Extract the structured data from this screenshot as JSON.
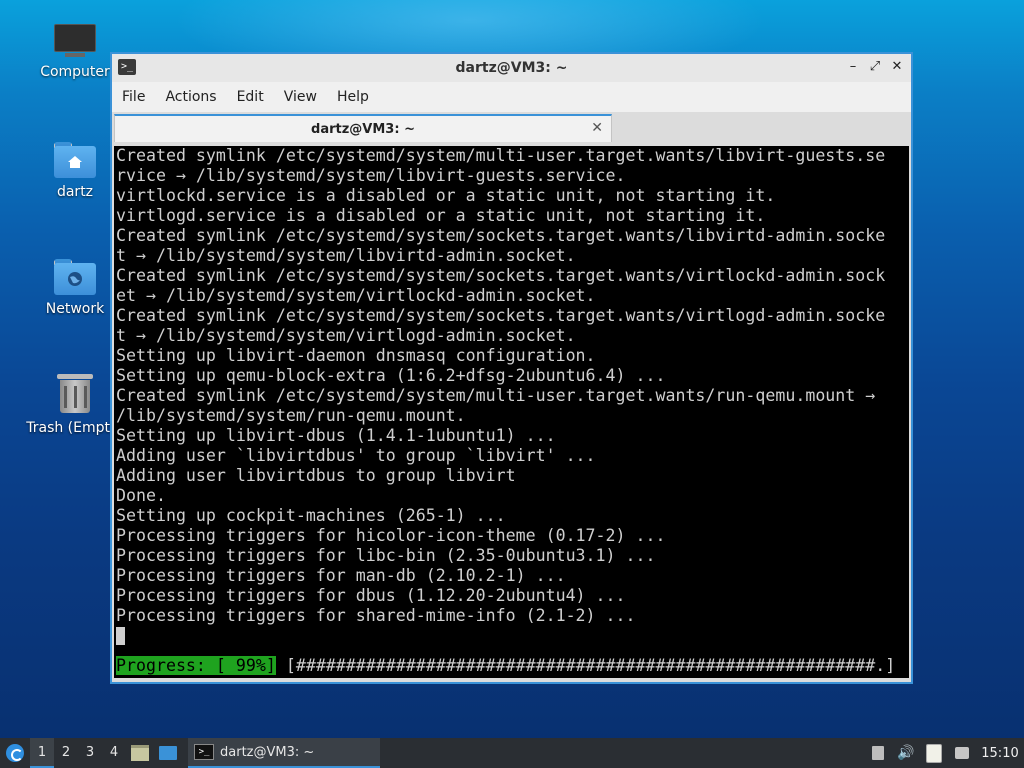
{
  "desktop": {
    "icons": [
      {
        "label": "Computer"
      },
      {
        "label": "dartz"
      },
      {
        "label": "Network"
      },
      {
        "label": "Trash (Empty)"
      }
    ]
  },
  "window": {
    "title": "dartz@VM3: ~",
    "app_icon": ">_",
    "menu": [
      "File",
      "Actions",
      "Edit",
      "View",
      "Help"
    ],
    "tab_label": "dartz@VM3: ~",
    "tab_close": "✕",
    "controls": {
      "minimize": "–",
      "maximize": "⤢",
      "close": "✕"
    }
  },
  "terminal": {
    "lines": [
      "Created symlink /etc/systemd/system/multi-user.target.wants/libvirt-guests.se",
      "rvice → /lib/systemd/system/libvirt-guests.service.",
      "virtlockd.service is a disabled or a static unit, not starting it.",
      "virtlogd.service is a disabled or a static unit, not starting it.",
      "Created symlink /etc/systemd/system/sockets.target.wants/libvirtd-admin.socke",
      "t → /lib/systemd/system/libvirtd-admin.socket.",
      "Created symlink /etc/systemd/system/sockets.target.wants/virtlockd-admin.sock",
      "et → /lib/systemd/system/virtlockd-admin.socket.",
      "Created symlink /etc/systemd/system/sockets.target.wants/virtlogd-admin.socke",
      "t → /lib/systemd/system/virtlogd-admin.socket.",
      "Setting up libvirt-daemon dnsmasq configuration.",
      "Setting up qemu-block-extra (1:6.2+dfsg-2ubuntu6.4) ...",
      "Created symlink /etc/systemd/system/multi-user.target.wants/run-qemu.mount →",
      "/lib/systemd/system/run-qemu.mount.",
      "Setting up libvirt-dbus (1.4.1-1ubuntu1) ...",
      "Adding user `libvirtdbus' to group `libvirt' ...",
      "Adding user libvirtdbus to group libvirt",
      "Done.",
      "Setting up cockpit-machines (265-1) ...",
      "Processing triggers for hicolor-icon-theme (0.17-2) ...",
      "Processing triggers for libc-bin (2.35-0ubuntu3.1) ...",
      "Processing triggers for man-db (2.10.2-1) ...",
      "Processing triggers for dbus (1.12.20-2ubuntu4) ...",
      "Processing triggers for shared-mime-info (2.1-2) ..."
    ],
    "progress_label": "Progress: [ 99%]",
    "progress_bar": " [##########################################################.]",
    "progress_percent": 99
  },
  "taskbar": {
    "workspaces": [
      "1",
      "2",
      "3",
      "4"
    ],
    "active_workspace": "1",
    "task_label": "dartz@VM3: ~",
    "task_icon": ">_",
    "volume_icon": "🔊",
    "clock": "15:10"
  },
  "colors": {
    "accent": "#3a92d8",
    "progress_green": "#1fa31f",
    "terminal_bg": "#000000",
    "terminal_fg": "#cfcfcf"
  }
}
